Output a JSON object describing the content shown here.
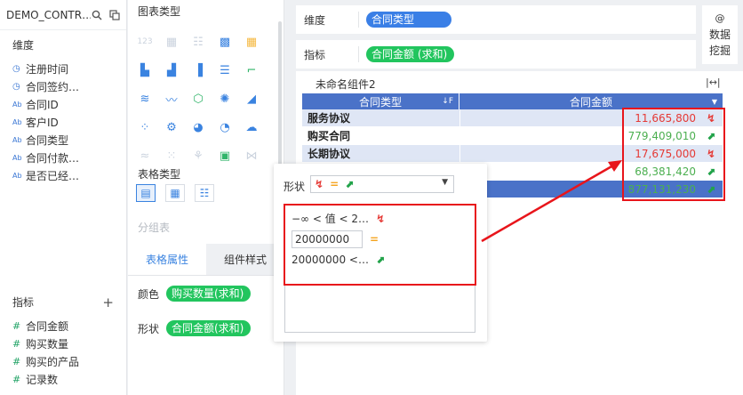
{
  "left_panel": {
    "dataset_name": "DEMO_CONTR…",
    "dimensions_title": "维度",
    "dimensions": [
      {
        "type": "clock",
        "label": "注册时间"
      },
      {
        "type": "clock",
        "label": "合同签约…"
      },
      {
        "type": "text",
        "label": "合同ID"
      },
      {
        "type": "text",
        "label": "客户ID"
      },
      {
        "type": "text",
        "label": "合同类型"
      },
      {
        "type": "text",
        "label": "合同付款…"
      },
      {
        "type": "text",
        "label": "是否已经…"
      }
    ],
    "metrics_title": "指标",
    "add_symbol": "+",
    "metrics": [
      {
        "label": "合同金额"
      },
      {
        "label": "购买数量"
      },
      {
        "label": "购买的产品"
      },
      {
        "label": "记录数"
      }
    ],
    "text_type_badge": "Ab",
    "num_type_badge": "#"
  },
  "middle_panel": {
    "chart_types_title": "图表类型",
    "table_types_title": "表格类型",
    "group_table_label": "分组表",
    "tabs": [
      "表格属性",
      "组件样式"
    ],
    "color_label": "颜色",
    "color_field": "购买数量(求和)",
    "shape_label": "形状",
    "shape_field": "合同金额(求和)"
  },
  "shelves": {
    "dimension_label": "维度",
    "dimension_field": "合同类型",
    "metric_label": "指标",
    "metric_field": "合同金额 (求和)",
    "mining_label_1": "数据",
    "mining_label_2": "挖掘",
    "mining_icon": "@"
  },
  "component": {
    "title": "未命名组件2",
    "columns": [
      "合同类型",
      "合同金额"
    ],
    "rows": [
      {
        "name": "服务协议",
        "value": "11,665,800",
        "color": "#e53935",
        "trend": "down"
      },
      {
        "name": "购买合同",
        "value": "779,409,010",
        "color": "#4caf50",
        "trend": "up"
      },
      {
        "name": "长期协议",
        "value": "17,675,000",
        "color": "#e53935",
        "trend": "down"
      },
      {
        "name": "",
        "value": "68,381,420",
        "color": "#4caf50",
        "trend": "up"
      },
      {
        "name": "",
        "value": "877,131,230",
        "color": "#4caf50",
        "trend": "up"
      }
    ]
  },
  "popup": {
    "shape_label": "形状",
    "rule_1": "−∞ < 值 < 2…",
    "threshold_value": "20000000",
    "rule_3": "20000000 <…"
  },
  "colors": {
    "accent": "#3a83e0",
    "table_header": "#4a72c8",
    "up": "#22a34a",
    "down": "#e53935",
    "equal": "#f5a623",
    "highlight": "#e8151b"
  }
}
